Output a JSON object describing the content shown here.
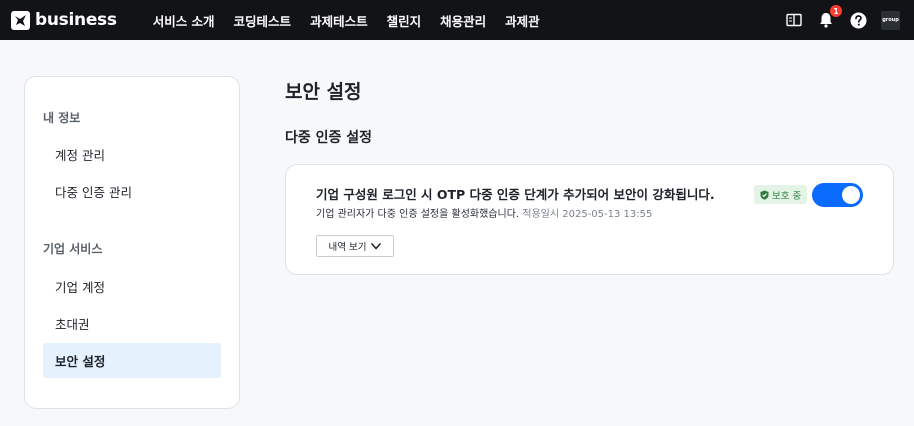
{
  "brand": {
    "name": "business"
  },
  "nav": [
    {
      "label": "서비스 소개"
    },
    {
      "label": "코딩테스트"
    },
    {
      "label": "과제테스트"
    },
    {
      "label": "챌린지"
    },
    {
      "label": "채용관리"
    },
    {
      "label": "과제관"
    }
  ],
  "topbar": {
    "notification_count": "1",
    "avatar_text": "group",
    "icons": [
      "book-icon",
      "bell-icon",
      "help-icon"
    ]
  },
  "sidebar": {
    "section_my": "내 정보",
    "items_my": [
      {
        "label": "계정 관리"
      },
      {
        "label": "다중 인증 관리"
      }
    ],
    "section_company": "기업 서비스",
    "items_company": [
      {
        "label": "기업 계정"
      },
      {
        "label": "초대권"
      },
      {
        "label": "보안 설정",
        "active": true
      }
    ]
  },
  "main": {
    "title": "보안 설정",
    "section_title": "다중 인증 설정",
    "card": {
      "headline": "기업 구성원 로그인 시 OTP 다중 인증 단계가 추가되어 보안이 강화됩니다.",
      "sub_text": "기업 관리자가 다중 인증 설정을 활성화했습니다.",
      "applied_label": "적용일시 2025-05-13 13:55",
      "history_button": "내역 보기",
      "badge": "보호 중",
      "toggle_on": true
    }
  },
  "colors": {
    "topbar_bg": "#111317",
    "accent": "#0b6bff",
    "active_item_bg": "#e5f1fd",
    "badge_bg": "#e3f4e6",
    "badge_text": "#2e7d3b",
    "notification": "#ff3b30"
  }
}
